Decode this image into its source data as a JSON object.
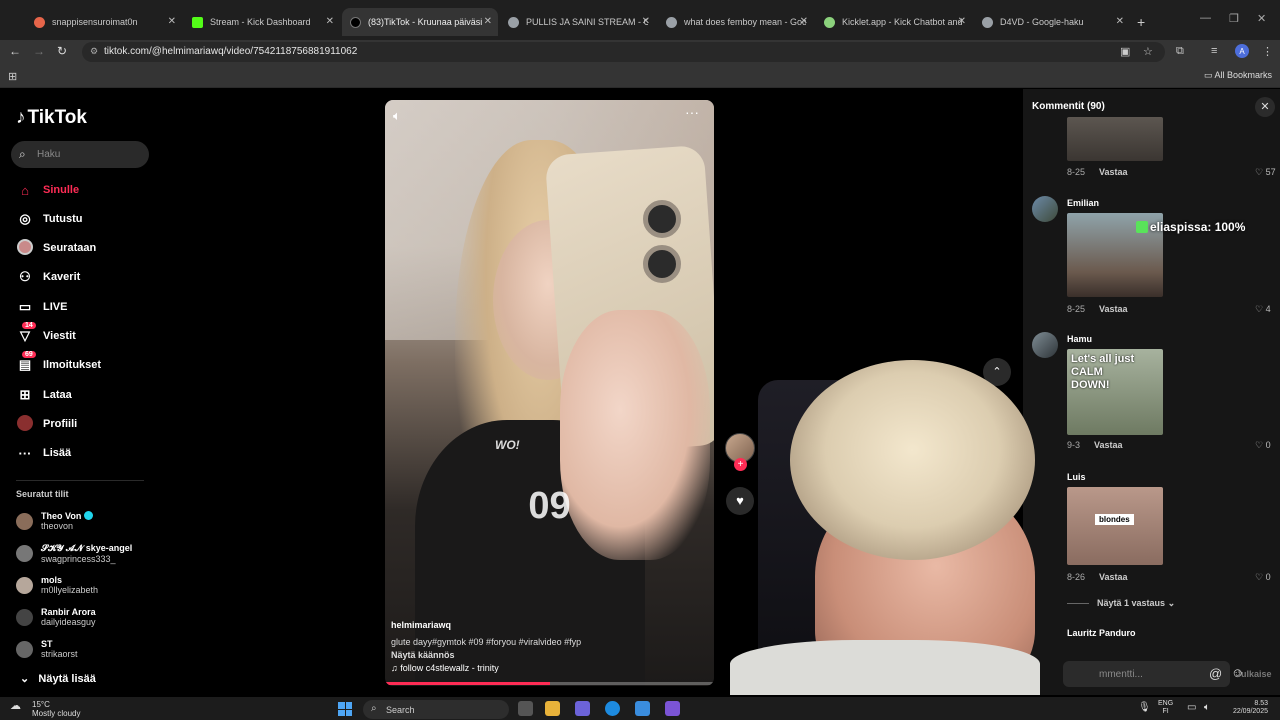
{
  "browser": {
    "tabs": [
      {
        "label": "snappisensuroimat0n",
        "favicon_color": "#e6654a"
      },
      {
        "label": "Stream - Kick Dashboard",
        "favicon_color": "#53fc18"
      },
      {
        "label": "(83)TikTok - Kruunaa päiväsi",
        "favicon_color": "#000000",
        "active": true
      },
      {
        "label": "PULLIS JA SAINI STREAM - Goo",
        "favicon_color": "#9aa0a6"
      },
      {
        "label": "what does femboy mean - Goo",
        "favicon_color": "#9aa0a6"
      },
      {
        "label": "Kicklet.app - Kick Chatbot and",
        "favicon_color": "#8bd17c"
      },
      {
        "label": "D4VD - Google-haku",
        "favicon_color": "#9aa0a6"
      }
    ],
    "url": "tiktok.com/@helmimariawq/video/7542118756881911062",
    "bookmarks_label": "All Bookmarks",
    "profile_initial": "A"
  },
  "tiktok": {
    "logo": "TikTok",
    "search_placeholder": "Haku",
    "nav": [
      {
        "label": "Sinulle",
        "icon": "home-icon",
        "active": true
      },
      {
        "label": "Tutustu",
        "icon": "compass-icon"
      },
      {
        "label": "Seurataan",
        "icon": "following-avatar-icon"
      },
      {
        "label": "Kaverit",
        "icon": "friends-icon"
      },
      {
        "label": "LIVE",
        "icon": "live-icon"
      },
      {
        "label": "Viestit",
        "icon": "messages-icon",
        "badge": "14"
      },
      {
        "label": "Ilmoitukset",
        "icon": "inbox-icon",
        "badge": "69"
      },
      {
        "label": "Lataa",
        "icon": "upload-icon"
      },
      {
        "label": "Profiili",
        "icon": "profile-icon"
      },
      {
        "label": "Lisää",
        "icon": "more-icon"
      }
    ],
    "following_header": "Seuratut tilit",
    "following": [
      {
        "name": "Theo Von",
        "user": "theovon",
        "verified": true,
        "color": "#8a6d5a"
      },
      {
        "name": "𝓢𝓚𝓨 𝓐𝓝 skye-angel",
        "user": "swagprincess333_",
        "color": "#777"
      },
      {
        "name": "mols",
        "user": "m0llyelizabeth",
        "color": "#b6a79b"
      },
      {
        "name": "Ranbir Arora",
        "user": "dailyideasguy",
        "color": "#444"
      },
      {
        "name": "ST",
        "user": "strikaorst",
        "color": "#666"
      }
    ],
    "show_more": "Näytä lisää"
  },
  "video": {
    "overlay_number": "09",
    "shirt_text": "WO!",
    "author": "helmimariawq",
    "description": "glute dayy#gymtok #09 #foryou #viralvideo #fyp",
    "translate": "Näytä käännös",
    "music": "♫ follow c4stlewallz - trinity",
    "progress": 0.5
  },
  "comments": {
    "title": "Kommentit (90)",
    "reply_label": "Vastaa",
    "items": [
      {
        "name": "",
        "date": "8-25",
        "likes": "57",
        "gif_text": ""
      },
      {
        "name": "Emilian",
        "date": "8-25",
        "likes": "4",
        "gif_text": ""
      },
      {
        "name": "Hamu",
        "date": "9-3",
        "likes": "0",
        "gif_text": "Let's all just CALM DOWN!"
      },
      {
        "name": "Luis",
        "date": "8-26",
        "likes": "0",
        "gif_text": "blondes"
      },
      {
        "name": "Lauritz Panduro",
        "date": "",
        "likes": "",
        "gif_text": ""
      }
    ],
    "more_replies": "Näytä 1 vastaus",
    "input_placeholder": "mmentti...",
    "post_label": "Julkaise"
  },
  "stream_overlay": {
    "chat_line": "eliaspissa: 100%"
  },
  "taskbar": {
    "weather_temp": "15°C",
    "weather_desc": "Mostly cloudy",
    "search_label": "Search",
    "lang_top": "ENG",
    "lang_bottom": "FI",
    "time": "8.53",
    "date": "22/09/2025"
  }
}
